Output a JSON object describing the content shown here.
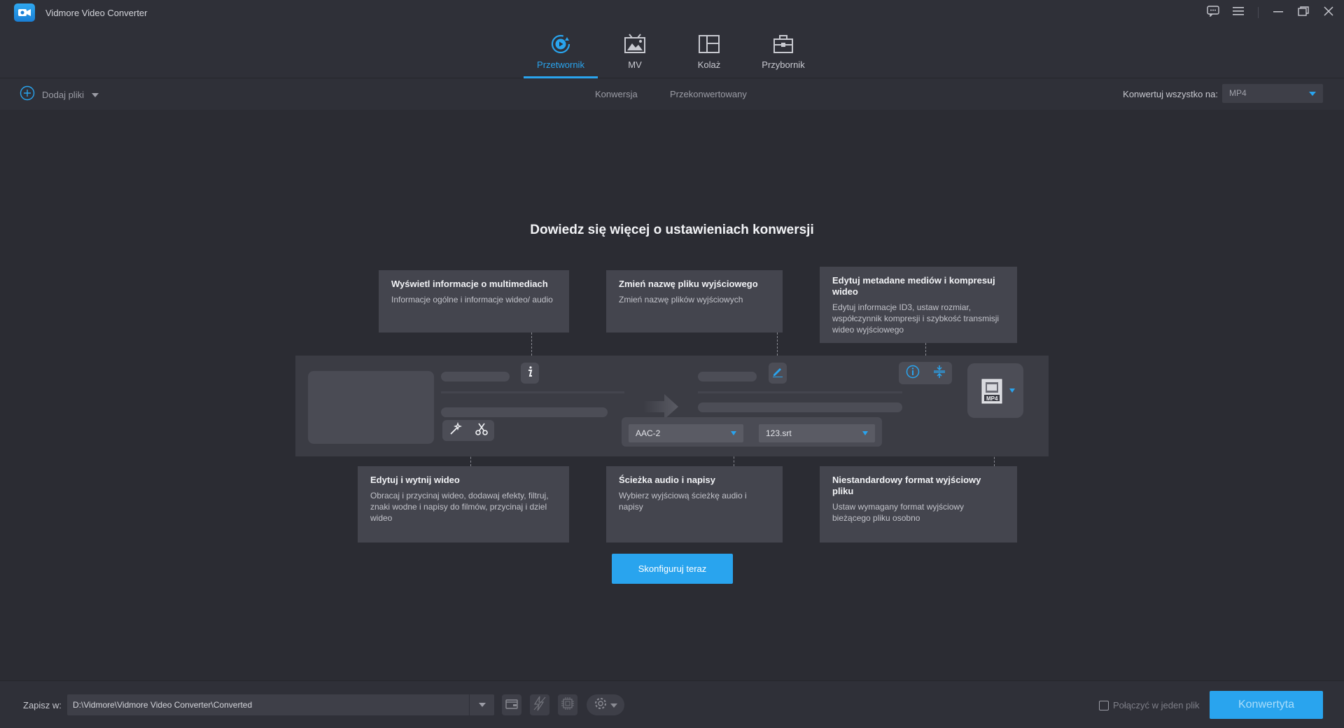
{
  "app": {
    "title": "Vidmore Video Converter"
  },
  "nav": {
    "tabs": [
      {
        "label": "Przetwornik",
        "icon": "converter-icon",
        "active": true
      },
      {
        "label": "MV",
        "icon": "mv-icon",
        "active": false
      },
      {
        "label": "Kolaż",
        "icon": "collage-icon",
        "active": false
      },
      {
        "label": "Przybornik",
        "icon": "toolbox-icon",
        "active": false
      }
    ]
  },
  "toolbar": {
    "add_files": "Dodaj pliki",
    "sub_tabs": [
      "Konwersja",
      "Przekonwertowany"
    ],
    "convert_all_label": "Konwertuj wszystko na:",
    "convert_all_value": "MP4"
  },
  "guide": {
    "title": "Dowiedz się więcej o ustawieniach konwersji",
    "cards": {
      "media_info": {
        "title": "Wyświetl informacje o multimediach",
        "desc": "Informacje ogólne i informacje wideo/ audio"
      },
      "rename": {
        "title": "Zmień nazwę pliku wyjściowego",
        "desc": "Zmień nazwę plików wyjściowych"
      },
      "metadata": {
        "title": "Edytuj metadane mediów i kompresuj wideo",
        "desc": "Edytuj informacje ID3, ustaw rozmiar, współczynnik kompresji i szybkość transmisji wideo wyjściowego"
      },
      "edit_cut": {
        "title": "Edytuj i wytnij wideo",
        "desc": "Obracaj i przycinaj wideo, dodawaj efekty, filtruj, znaki wodne i napisy do filmów, przycinaj i dziel wideo"
      },
      "audio_subs": {
        "title": "Ścieżka audio i napisy",
        "desc": "Wybierz wyjściową ścieżkę audio i napisy"
      },
      "custom_format": {
        "title": "Niestandardowy format wyjściowy pliku",
        "desc": "Ustaw wymagany format wyjściowy bieżącego pliku osobno"
      }
    },
    "demo": {
      "audio_track": "AAC-2",
      "subtitle": "123.srt",
      "format_badge": "MP4",
      "info_glyph": "i"
    },
    "configure_button": "Skonfiguruj teraz"
  },
  "footer": {
    "save_label": "Zapisz w:",
    "save_path": "D:\\Vidmore\\Vidmore Video Converter\\Converted",
    "merge_label": "Połączyć w jeden plik",
    "convert_button": "Konwertyta"
  },
  "colors": {
    "accent": "#29a4ee",
    "background": "#2b2c33",
    "panel": "#2f3038",
    "card": "#44454e"
  }
}
